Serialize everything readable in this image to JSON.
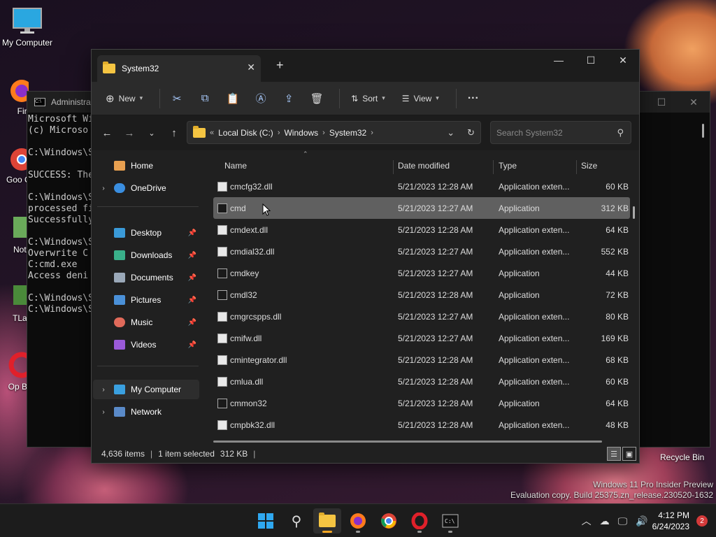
{
  "desktop": {
    "icons": [
      "My Computer",
      "Fire",
      "Goo Chro",
      "Notep",
      "TLaun",
      "Op Brow"
    ],
    "recycle_bin": "Recycle Bin",
    "watermark_line1": "Windows 11 Pro Insider Preview",
    "watermark_line2": "Evaluation copy. Build 25375.zn_release.230520-1632"
  },
  "cmd": {
    "title": "Administra",
    "lines": [
      "Microsoft Wi",
      "(c) Microso",
      "",
      "C:\\Windows\\S",
      "",
      "SUCCESS: The",
      "",
      "C:\\Windows\\S",
      "processed fi",
      "Successfully",
      "",
      "C:\\Windows\\S",
      "Overwrite C",
      "C:cmd.exe",
      "Access deni",
      "",
      "C:\\Windows\\S",
      "C:\\Windows\\S"
    ]
  },
  "explorer": {
    "tab_title": "System32",
    "toolbar": {
      "new_label": "New",
      "sort_label": "Sort",
      "view_label": "View",
      "more_label": "···"
    },
    "breadcrumb": [
      "Local Disk (C:)",
      "Windows",
      "System32"
    ],
    "breadcrumb_prefix": "«",
    "search_placeholder": "Search System32",
    "sidebar": {
      "home": "Home",
      "onedrive": "OneDrive",
      "desktop": "Desktop",
      "downloads": "Downloads",
      "documents": "Documents",
      "pictures": "Pictures",
      "music": "Music",
      "videos": "Videos",
      "mycomputer": "My Computer",
      "network": "Network"
    },
    "columns": {
      "name": "Name",
      "date": "Date modified",
      "type": "Type",
      "size": "Size"
    },
    "files": [
      {
        "name": "cmcfg32.dll",
        "date": "5/21/2023 12:28 AM",
        "type": "Application exten...",
        "size": "60 KB",
        "kind": "dll"
      },
      {
        "name": "cmd",
        "date": "5/21/2023 12:27 AM",
        "type": "Application",
        "size": "312 KB",
        "kind": "app"
      },
      {
        "name": "cmdext.dll",
        "date": "5/21/2023 12:28 AM",
        "type": "Application exten...",
        "size": "64 KB",
        "kind": "dll"
      },
      {
        "name": "cmdial32.dll",
        "date": "5/21/2023 12:27 AM",
        "type": "Application exten...",
        "size": "552 KB",
        "kind": "dll"
      },
      {
        "name": "cmdkey",
        "date": "5/21/2023 12:27 AM",
        "type": "Application",
        "size": "44 KB",
        "kind": "app"
      },
      {
        "name": "cmdl32",
        "date": "5/21/2023 12:28 AM",
        "type": "Application",
        "size": "72 KB",
        "kind": "app"
      },
      {
        "name": "cmgrcspps.dll",
        "date": "5/21/2023 12:27 AM",
        "type": "Application exten...",
        "size": "80 KB",
        "kind": "dll"
      },
      {
        "name": "cmifw.dll",
        "date": "5/21/2023 12:27 AM",
        "type": "Application exten...",
        "size": "169 KB",
        "kind": "dll"
      },
      {
        "name": "cmintegrator.dll",
        "date": "5/21/2023 12:28 AM",
        "type": "Application exten...",
        "size": "68 KB",
        "kind": "dll"
      },
      {
        "name": "cmlua.dll",
        "date": "5/21/2023 12:28 AM",
        "type": "Application exten...",
        "size": "60 KB",
        "kind": "dll"
      },
      {
        "name": "cmmon32",
        "date": "5/21/2023 12:28 AM",
        "type": "Application",
        "size": "64 KB",
        "kind": "app"
      },
      {
        "name": "cmpbk32.dll",
        "date": "5/21/2023 12:28 AM",
        "type": "Application exten...",
        "size": "48 KB",
        "kind": "dll"
      }
    ],
    "status": {
      "items": "4,636 items",
      "selected": "1 item selected",
      "size": "312 KB"
    }
  },
  "taskbar": {
    "time": "4:12 PM",
    "date": "6/24/2023",
    "notifications": "2"
  },
  "colors": {
    "accent": "#f5a623",
    "selection": "#606060",
    "folder": "#f5c542"
  }
}
